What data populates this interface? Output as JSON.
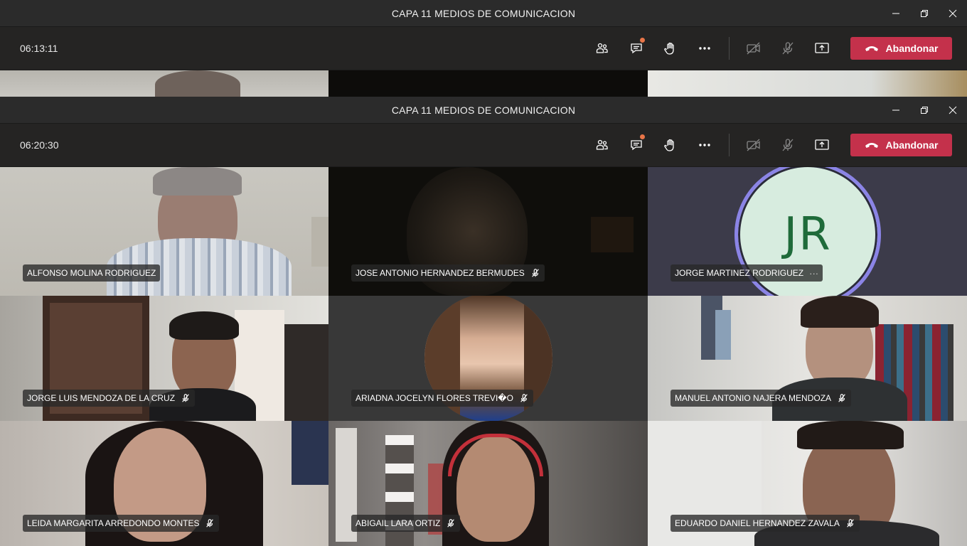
{
  "back_window": {
    "title": "CAPA 11 MEDIOS DE COMUNICACION",
    "timer": "06:13:11",
    "leave_label": "Abandonar"
  },
  "front_window": {
    "title": "CAPA 11 MEDIOS DE COMUNICACION",
    "timer": "06:20:30",
    "leave_label": "Abandonar"
  },
  "toolbar_icons": [
    "participants-icon",
    "chat-icon",
    "raise-hand-icon",
    "more-options-icon",
    "camera-off-icon",
    "mic-off-icon",
    "share-screen-icon",
    "hang-up-icon"
  ],
  "colors": {
    "leave": "#c4314b",
    "chat_badge": "#e97548",
    "avatar_ring": "#8b84e6",
    "avatar_bg": "#d7ecdf",
    "avatar_text": "#1f6b3a"
  },
  "participants": [
    {
      "name": "ALFONSO MOLINA RODRIGUEZ",
      "muted": false
    },
    {
      "name": "JOSE ANTONIO HERNANDEZ BERMUDES",
      "muted": true
    },
    {
      "name": "JORGE MARTINEZ RODRIGUEZ",
      "muted": false,
      "avatar_initials": "JR",
      "more": "···"
    },
    {
      "name": "JORGE LUIS MENDOZA DE LA CRUZ",
      "muted": true
    },
    {
      "name": "ARIADNA JOCELYN FLORES TREVI�O",
      "muted": true
    },
    {
      "name": "MANUEL ANTONIO NAJERA MENDOZA",
      "muted": true
    },
    {
      "name": "LEIDA MARGARITA ARREDONDO MONTES",
      "muted": true
    },
    {
      "name": "ABIGAIL LARA ORTIZ",
      "muted": true
    },
    {
      "name": "EDUARDO DANIEL HERNANDEZ ZAVALA",
      "muted": true
    }
  ]
}
